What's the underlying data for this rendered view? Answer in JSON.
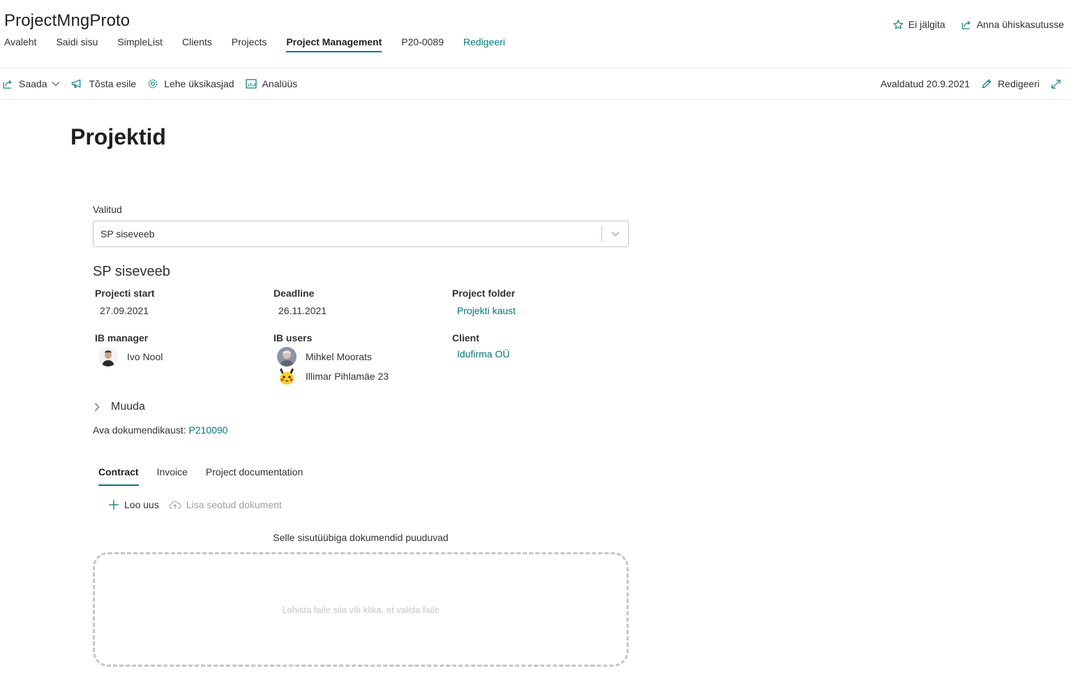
{
  "site": {
    "title": "ProjectMngProto"
  },
  "nav": {
    "items": [
      {
        "label": "Avaleht"
      },
      {
        "label": "Saidi sisu"
      },
      {
        "label": "SimpleList"
      },
      {
        "label": "Clients"
      },
      {
        "label": "Projects"
      },
      {
        "label": "Project Management",
        "active": true
      },
      {
        "label": "P20-0089"
      }
    ],
    "edit_label": "Redigeeri"
  },
  "site_actions": {
    "follow_label": "Ei jälgita",
    "share_label": "Anna ühiskasutusse"
  },
  "command_bar": {
    "send_label": "Saada",
    "promote_label": "Tõsta esile",
    "page_details_label": "Lehe üksikasjad",
    "analytics_label": "Analüüs",
    "published_label": "Avaldatud 20.9.2021",
    "edit_label": "Redigeeri"
  },
  "page": {
    "title": "Projektid"
  },
  "selector": {
    "label": "Valitud",
    "selected": "SP siseveeb"
  },
  "project": {
    "name": "SP siseveeb",
    "start_label": "Projecti start",
    "start_value": "27.09.2021",
    "deadline_label": "Deadline",
    "deadline_value": "26.11.2021",
    "folder_label": "Project folder",
    "folder_value": "Projekti kaust",
    "manager_label": "IB manager",
    "manager_name": "Ivo Nool",
    "users_label": "IB users",
    "users": [
      {
        "name": "Mihkel Moorats"
      },
      {
        "name": "Illimar Pihlamäe 23"
      }
    ],
    "client_label": "Client",
    "client_value": "Idufirma OÜ"
  },
  "muuda_label": "Muuda",
  "doc_folder": {
    "label": "Ava dokumendikaust:",
    "link": "P210090"
  },
  "tabs": [
    {
      "label": "Contract",
      "active": true
    },
    {
      "label": "Invoice"
    },
    {
      "label": "Project documentation"
    }
  ],
  "doc_commands": {
    "new_label": "Loo uus",
    "add_related_label": "Lisa seotud dokument"
  },
  "empty_message": "Selle sisutüübiga dokumendid puuduvad",
  "dropzone_text": "Lohista faile siia või klika, et valida faile",
  "colors": {
    "accent": "#03787c",
    "text": "#323130",
    "border": "#c8c6c4",
    "disabled": "#a19f9d"
  }
}
